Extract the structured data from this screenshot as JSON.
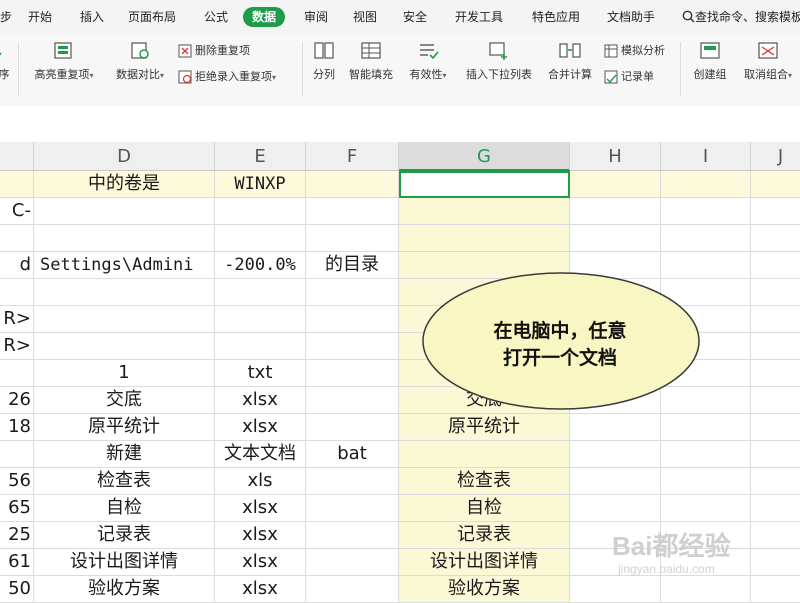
{
  "tabs": [
    {
      "label": "步"
    },
    {
      "label": "开始"
    },
    {
      "label": "插入"
    },
    {
      "label": "页面布局"
    },
    {
      "label": "公式"
    },
    {
      "label": "数据",
      "active": true
    },
    {
      "label": "审阅"
    },
    {
      "label": "视图"
    },
    {
      "label": "安全"
    },
    {
      "label": "开发工具"
    },
    {
      "label": "特色应用"
    },
    {
      "label": "文档助手"
    }
  ],
  "search": {
    "label": "查找命令、搜索模板"
  },
  "ribbon": {
    "sort_fragment": "序",
    "highlight_dup": "高亮重复项",
    "data_compare": "数据对比",
    "remove_dup": "删除重复项",
    "reject_dup": "拒绝录入重复项",
    "split": "分列",
    "smart_fill": "智能填充",
    "validity": "有效性",
    "insert_dropdown": "插入下拉列表",
    "merge_calc": "合并计算",
    "simulate": "模拟分析",
    "record_sheet": "记录单",
    "create_group": "创建组",
    "ungroup": "取消组合"
  },
  "columns": [
    "D",
    "E",
    "F",
    "G",
    "H",
    "I",
    "J"
  ],
  "rows": [
    {
      "c": "",
      "d": "中的卷是",
      "e": "WINXP",
      "f": "",
      "g": ""
    },
    {
      "c": "C-",
      "d": "",
      "e": "",
      "f": "",
      "g": ""
    },
    {
      "c": "",
      "d": "",
      "e": "",
      "f": "",
      "g": ""
    },
    {
      "c": "d",
      "d": "Settings\\Admini",
      "e": "-200.0%",
      "f": "的目录",
      "g": ""
    },
    {
      "c": "",
      "d": "",
      "e": "",
      "f": "",
      "g": ""
    },
    {
      "c": "R>",
      "d": "",
      "e": "",
      "f": "",
      "g": ""
    },
    {
      "c": "R>",
      "d": "",
      "e": "",
      "f": "",
      "g": ""
    },
    {
      "c": "",
      "d": "1",
      "e": "txt",
      "f": "",
      "g": ""
    },
    {
      "c": "26",
      "d": "交底",
      "e": "xlsx",
      "f": "",
      "g": "交底"
    },
    {
      "c": "18",
      "d": "原平统计",
      "e": "xlsx",
      "f": "",
      "g": "原平统计"
    },
    {
      "c": "",
      "d": "新建",
      "e": "文本文档",
      "f": "bat",
      "g": ""
    },
    {
      "c": "56",
      "d": "检查表",
      "e": "xls",
      "f": "",
      "g": "检查表"
    },
    {
      "c": "65",
      "d": "自检",
      "e": "xlsx",
      "f": "",
      "g": "自检"
    },
    {
      "c": "25",
      "d": "记录表",
      "e": "xlsx",
      "f": "",
      "g": "记录表"
    },
    {
      "c": "61",
      "d": "设计出图详情",
      "e": "xlsx",
      "f": "",
      "g": "设计出图详情"
    },
    {
      "c": "50",
      "d": "验收方案",
      "e": "xlsx",
      "f": "",
      "g": "验收方案"
    }
  ],
  "callout": {
    "line1": "在电脑中，任意",
    "line2": "打开一个文档"
  },
  "watermark": {
    "brand": "Bai都经验",
    "url": "jingyan.baidu.com"
  },
  "colors": {
    "accent": "#1e9c4a",
    "highlight_row": "#fcfadb",
    "highlight_col": "#fbf8d6",
    "callout_fill": "#f8f6c3"
  }
}
